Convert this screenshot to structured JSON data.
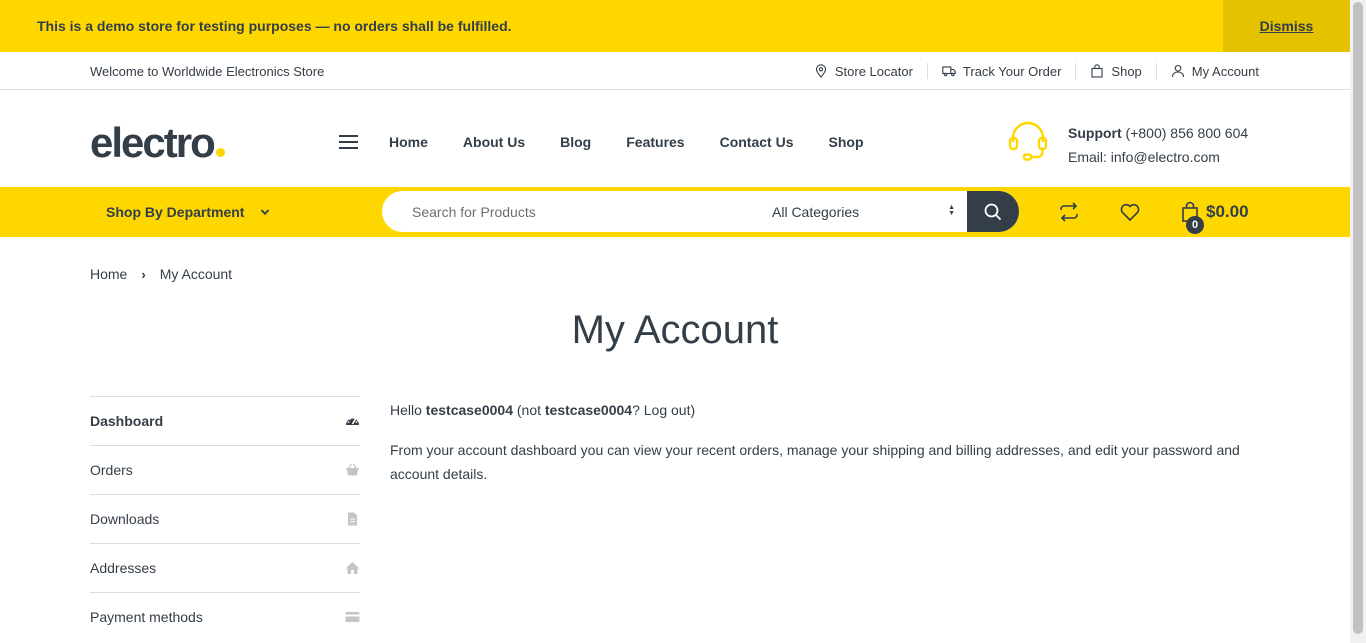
{
  "notice": {
    "text": "This is a demo store for testing purposes — no orders shall be fulfilled.",
    "dismiss": "Dismiss"
  },
  "topbar": {
    "welcome": "Welcome to Worldwide Electronics Store",
    "links": [
      {
        "label": "Store Locator",
        "icon": "map-pin-icon"
      },
      {
        "label": "Track Your Order",
        "icon": "truck-icon"
      },
      {
        "label": "Shop",
        "icon": "shopping-bag-icon"
      },
      {
        "label": "My Account",
        "icon": "user-icon"
      }
    ]
  },
  "header": {
    "logo": "electro",
    "nav": [
      "Home",
      "About Us",
      "Blog",
      "Features",
      "Contact Us",
      "Shop"
    ],
    "support_label": "Support",
    "support_phone": "(+800) 856 800 604",
    "support_email": "Email: info@electro.com"
  },
  "searchbar": {
    "department": "Shop By Department",
    "placeholder": "Search for Products",
    "category": "All Categories",
    "cart_count": "0",
    "cart_total": "$0.00"
  },
  "breadcrumb": {
    "home": "Home",
    "current": "My Account"
  },
  "page_title": "My Account",
  "sidebar": [
    {
      "label": "Dashboard",
      "icon": "dashboard-icon",
      "active": true
    },
    {
      "label": "Orders",
      "icon": "basket-icon"
    },
    {
      "label": "Downloads",
      "icon": "file-icon"
    },
    {
      "label": "Addresses",
      "icon": "home-icon"
    },
    {
      "label": "Payment methods",
      "icon": "credit-card-icon"
    }
  ],
  "content": {
    "hello": "Hello",
    "username": "testcase0004",
    "not_prefix": "(not",
    "not_user": "testcase0004",
    "logout": "? Log out)",
    "description": "From your account dashboard you can view your recent orders, manage your shipping and billing addresses, and edit your password and account details."
  },
  "colors": {
    "accent": "#fed700",
    "dark": "#333e48",
    "dismiss_bg": "#e4c200"
  }
}
